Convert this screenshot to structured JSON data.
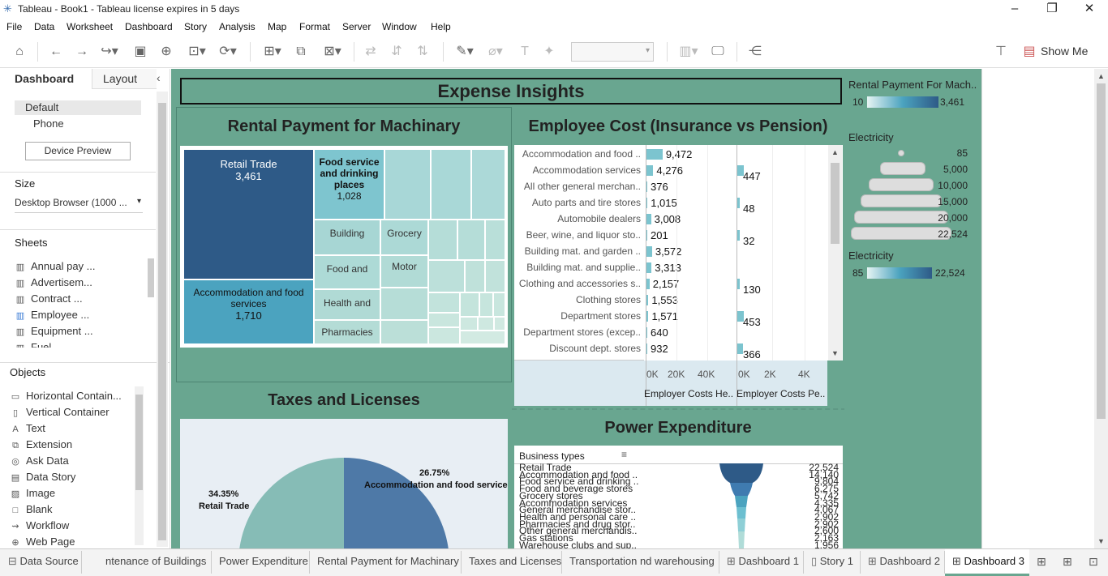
{
  "window": {
    "title": "Tableau - Book1 - Tableau license expires in 5 days"
  },
  "menu": [
    "File",
    "Data",
    "Worksheet",
    "Dashboard",
    "Story",
    "Analysis",
    "Map",
    "Format",
    "Server",
    "Window",
    "Help"
  ],
  "toolbar": {
    "show_me": "Show Me"
  },
  "left_panel": {
    "tab_dashboard": "Dashboard",
    "tab_layout": "Layout",
    "device_default": "Default",
    "device_phone": "Phone",
    "device_preview": "Device Preview",
    "size_title": "Size",
    "size_value": "Desktop Browser (1000 ...",
    "sheets_title": "Sheets",
    "sheets": [
      "Annual pay ...",
      "Advertisem...",
      "Contract ...",
      "Employee ...",
      "Equipment ...",
      "Fuel"
    ],
    "objects_title": "Objects",
    "objects": [
      {
        "label": "Horizontal Contain...",
        "icon": "horizontal-container-icon"
      },
      {
        "label": "Vertical Container",
        "icon": "vertical-container-icon"
      },
      {
        "label": "Text",
        "icon": "text-icon"
      },
      {
        "label": "Extension",
        "icon": "extension-icon"
      },
      {
        "label": "Ask Data",
        "icon": "ask-data-icon"
      },
      {
        "label": "Data Story",
        "icon": "data-story-icon"
      },
      {
        "label": "Image",
        "icon": "image-icon"
      },
      {
        "label": "Blank",
        "icon": "blank-icon"
      },
      {
        "label": "Workflow",
        "icon": "workflow-icon"
      },
      {
        "label": "Web Page",
        "icon": "web-page-icon"
      }
    ]
  },
  "dashboard": {
    "title": "Expense Insights",
    "treemap": {
      "title": "Rental Payment for Machinary",
      "cells": [
        {
          "label": "Retail Trade",
          "value": "3,461"
        },
        {
          "label": "Accommodation and food services",
          "value": "1,710"
        },
        {
          "label": "Food service and drinking places",
          "value": "1,028"
        },
        {
          "label": "Building",
          "value": ""
        },
        {
          "label": "Grocery",
          "value": ""
        },
        {
          "label": "Food and",
          "value": ""
        },
        {
          "label": "Motor",
          "value": ""
        },
        {
          "label": "Health and",
          "value": ""
        },
        {
          "label": "Pharmacies",
          "value": ""
        }
      ]
    },
    "employee": {
      "title": "Employee Cost (Insurance vs Pension)",
      "axis1_label": "Employer Costs He..",
      "axis2_label": "Employer Costs Pe..",
      "axis1_ticks": [
        "0K",
        "20K",
        "40K"
      ],
      "axis2_ticks": [
        "0K",
        "2K",
        "4K"
      ]
    },
    "taxes": {
      "title": "Taxes and Licenses",
      "slice1_pct": "26.75%",
      "slice1_label": "Accommodation and food services",
      "slice2_pct": "34.35%",
      "slice2_label": "Retail Trade"
    },
    "power": {
      "title": "Power Expenditure",
      "header": "Business types"
    }
  },
  "legends": {
    "rental_title": "Rental Payment For Mach..",
    "rental_min": "10",
    "rental_max": "3,461",
    "electricity_size_title": "Electricity",
    "size_values": [
      "85",
      "5,000",
      "10,000",
      "15,000",
      "20,000",
      "22,524"
    ],
    "electricity_color_title": "Electricity",
    "elec_min": "85",
    "elec_max": "22,524"
  },
  "bottom_tabs": [
    "Data Source",
    "ntenance of Buildings",
    "Power Expenditure",
    "Rental Payment for Machinary",
    "Taxes and Licenses",
    "Transportation nd warehousing",
    "Dashboard 1",
    "Story 1",
    "Dashboard 2",
    "Dashboard 3"
  ],
  "colors": {
    "dashboard_bg": "#69a690",
    "treemap_dark": "#2e5a87",
    "treemap_mid": "#4ba3bf",
    "bar": "#7cc4cf",
    "pie_retail": "#4e79a7",
    "pie_accom": "#86bcb6"
  },
  "chart_data": [
    {
      "type": "bar",
      "title": "Employee Cost (Insurance vs Pension)",
      "categories": [
        "Accommodation and food ..",
        "Accommodation services",
        "All other general merchan..",
        "Auto parts and tire stores",
        "Automobile dealers",
        "Beer, wine, and liquor sto..",
        "Building mat. and garden ..",
        "Building mat. and supplie..",
        "Clothing and accessories s..",
        "Clothing stores",
        "Department stores",
        "Department stores (excep..",
        "Discount dept. stores"
      ],
      "series": [
        {
          "name": "Employer Costs He..",
          "values": [
            9472,
            4276,
            376,
            1015,
            3008,
            201,
            3572,
            3313,
            2157,
            1553,
            1571,
            640,
            932
          ]
        },
        {
          "name": "Employer Costs Pe..",
          "values": [
            null,
            447,
            null,
            48,
            null,
            32,
            null,
            null,
            130,
            null,
            453,
            null,
            366
          ]
        }
      ],
      "xlabel": "Employer Costs He..",
      "ylabel": ""
    },
    {
      "type": "table",
      "title": "Power Expenditure",
      "categories": [
        "Retail Trade",
        "Accommodation and food ..",
        "Food service and drinking ..",
        "Food and beverage stores",
        "Grocery stores",
        "Accommodation services",
        "General merchandise stor..",
        "Health and personal care ..",
        "Pharmacies and drug stor..",
        "Other general merchandis..",
        "Gas stations",
        "Warehouse clubs and sup.."
      ],
      "values": [
        "22,524",
        "14,140",
        "9,804",
        "6,275",
        "5,742",
        "4,335",
        "4,067",
        "2,902",
        "2,902",
        "2,600",
        "2,163",
        "1,956"
      ]
    }
  ]
}
